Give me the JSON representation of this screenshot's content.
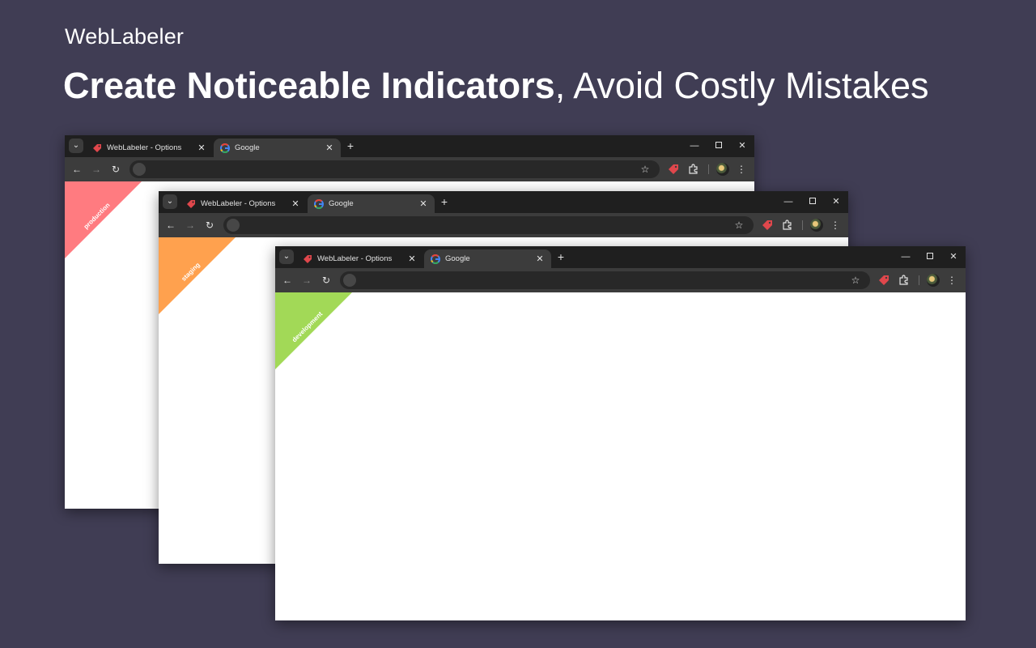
{
  "brand": "WebLabeler",
  "headline": {
    "bold": "Create Noticeable Indicators",
    "rest": ", Avoid Costly Mistakes"
  },
  "windows": [
    {
      "tabs": [
        {
          "title": "WebLabeler - Options",
          "icon": "tag-icon"
        },
        {
          "title": "Google",
          "icon": "google-icon",
          "active": true
        }
      ],
      "label": "production",
      "label_color": "#ff7b80"
    },
    {
      "tabs": [
        {
          "title": "WebLabeler - Options",
          "icon": "tag-icon"
        },
        {
          "title": "Google",
          "icon": "google-icon",
          "active": true
        }
      ],
      "label": "staging",
      "label_color": "#ffa14e"
    },
    {
      "tabs": [
        {
          "title": "WebLabeler - Options",
          "icon": "tag-icon"
        },
        {
          "title": "Google",
          "icon": "google-icon",
          "active": true
        }
      ],
      "label": "development",
      "label_color": "#a2d957"
    }
  ],
  "colors": {
    "background": "#403d54",
    "titlebar": "#1f1f1f",
    "toolbar": "#3c3c3c",
    "extension_tag": "#e0474c"
  }
}
